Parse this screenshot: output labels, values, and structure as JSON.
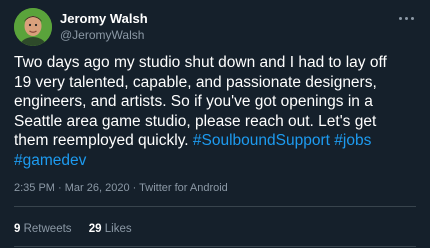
{
  "author": {
    "name": "Jeromy Walsh",
    "handle": "@JeromyWalsh"
  },
  "tweet": {
    "lines": [
      "Two days ago my studio shut down and I had to lay off",
      "19 very talented, capable, and passionate designers,",
      "engineers, and artists. So if you've got openings in a",
      "Seattle area game studio, please reach out. Let's get"
    ],
    "line5_text": "them reemployed quickly. ",
    "hashtag1": "#SoulboundSupport",
    "hashtag2": "#jobs",
    "hashtag3": "#gamedev"
  },
  "meta": "2:35 PM · Mar 26, 2020 · Twitter for Android",
  "stats": {
    "retweets_count": "9",
    "retweets_label": "Retweets",
    "likes_count": "29",
    "likes_label": "Likes"
  },
  "colors": {
    "background": "#15202b",
    "link": "#1d9bf0",
    "secondary_text": "#8b98a5"
  },
  "icons": {
    "more": "more-options-icon"
  }
}
